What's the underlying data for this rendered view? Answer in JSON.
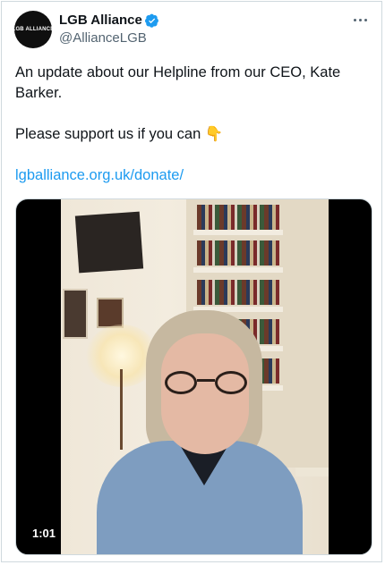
{
  "account": {
    "name": "LGB Alliance",
    "handle": "@AllianceLGB",
    "avatar_text": "LGB ALLIANCE",
    "verified": true
  },
  "tweet": {
    "line1": "An update about our Helpline from our CEO, Kate Barker.",
    "line2_text": "Please support us if you can ",
    "line2_emoji": "👇",
    "link": "lgballiance.org.uk/donate/"
  },
  "video": {
    "duration": "1:01"
  },
  "icons": {
    "more": "more-horizontal-icon",
    "verified": "verified-badge-icon"
  },
  "colors": {
    "link": "#1d9bf0",
    "verified": "#1d9bf0",
    "text": "#0f1419",
    "secondary": "#536471"
  }
}
